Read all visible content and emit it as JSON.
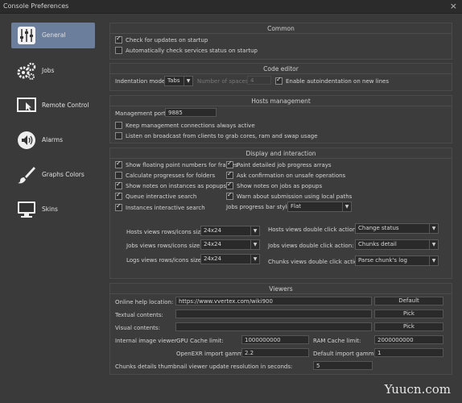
{
  "window": {
    "title": "Console Preferences",
    "close": "×"
  },
  "sidebar": {
    "items": [
      {
        "label": "General",
        "icon": "sliders-icon",
        "active": true
      },
      {
        "label": "Jobs",
        "icon": "gears-icon"
      },
      {
        "label": "Remote Control",
        "icon": "remote-screen-icon"
      },
      {
        "label": "Alarms",
        "icon": "speaker-icon"
      },
      {
        "label": "Graphs Colors",
        "icon": "brush-icon"
      },
      {
        "label": "Skins",
        "icon": "monitor-icon"
      }
    ]
  },
  "common": {
    "title": "Common",
    "check_updates": "Check for updates on startup",
    "check_services": "Automatically check services status on startup"
  },
  "code_editor": {
    "title": "Code editor",
    "indentation_label": "Indentation mode:",
    "indentation_value": "Tabs",
    "spaces_label": "Number of spaces:",
    "spaces_value": "4",
    "auto_indent": "Enable autoindentation on new lines"
  },
  "hosts": {
    "title": "Hosts management",
    "port_label": "Management port:",
    "port_value": "9885",
    "keep_conn": "Keep management connections always active",
    "listen_broadcast": "Listen on broadcast from clients to grab cores, ram and swap usage"
  },
  "display": {
    "title": "Display and interaction",
    "left": [
      "Show floating point numbers for frames",
      "Calculate progresses for folders",
      "Show notes on instances as popups",
      "Queue interactive search",
      "Instances interactive search"
    ],
    "right": [
      "Paint detailed job progress arrays",
      "Ask confirmation on unsafe operations",
      "Show notes on jobs as popups",
      "Warn about submission using local paths"
    ],
    "bar_style_label": "Jobs progress bar style:",
    "bar_style_value": "Flat",
    "hosts_size_label": "Hosts views rows/icons size:",
    "hosts_size_value": "24x24",
    "jobs_size_label": "Jobs views rows/icons size:",
    "jobs_size_value": "24x24",
    "logs_size_label": "Logs views rows/icons size:",
    "logs_size_value": "24x24",
    "hosts_dbl_label": "Hosts views double click action:",
    "hosts_dbl_value": "Change status",
    "jobs_dbl_label": "Jobs views double click action:",
    "jobs_dbl_value": "Chunks detail",
    "chunks_dbl_label": "Chunks views double click action:",
    "chunks_dbl_value": "Parse chunk's log"
  },
  "viewers": {
    "title": "Viewers",
    "help_label": "Online help location:",
    "help_value": "https://www.vvertex.com/wiki900",
    "default_btn": "Default",
    "textual_label": "Textual contents:",
    "pick1": "Pick",
    "visual_label": "Visual contents:",
    "pick2": "Pick",
    "image_viewer_label": "Internal image viewer",
    "gpu_label": "GPU Cache limit:",
    "gpu_value": "1000000000",
    "ram_label": "RAM Cache limit:",
    "ram_value": "2000000000",
    "exr_label": "OpenEXR import gamma:",
    "exr_value": "2.2",
    "def_gamma_label": "Default import gamma:",
    "def_gamma_value": "1",
    "thumb_label": "Chunks details thumbnail viewer update resolution in seconds:",
    "thumb_value": "5"
  },
  "watermark": "Yuucn.com"
}
